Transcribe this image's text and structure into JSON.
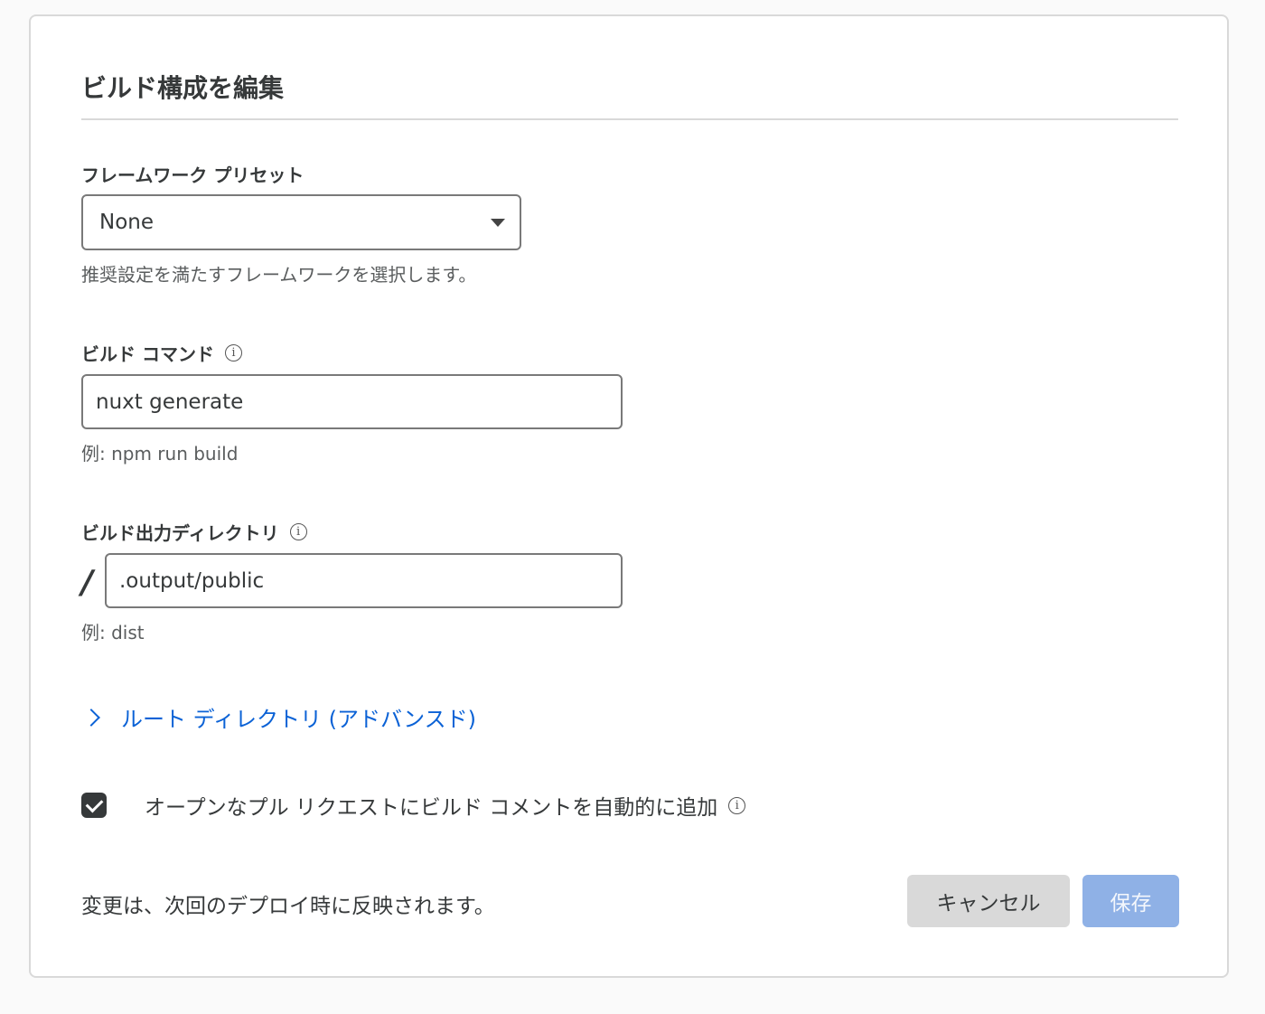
{
  "dialog": {
    "title": "ビルド構成を編集"
  },
  "framework": {
    "label": "フレームワーク プリセット",
    "selected": "None",
    "help": "推奨設定を満たすフレームワークを選択します。"
  },
  "build_command": {
    "label": "ビルド コマンド",
    "value": "nuxt generate",
    "help": "例: npm run build"
  },
  "output_dir": {
    "label": "ビルド出力ディレクトリ",
    "prefix": "/",
    "value": ".output/public",
    "help": "例: dist"
  },
  "root_dir": {
    "label": "ルート ディレクトリ (アドバンスド)"
  },
  "pr_comments": {
    "label": "オープンなプル リクエストにビルド コメントを自動的に追加",
    "checked": true
  },
  "footer": {
    "note": "変更は、次回のデプロイ時に反映されます。",
    "cancel_label": "キャンセル",
    "save_label": "保存"
  },
  "icons": {
    "info": "info-icon",
    "caret": "caret-down-icon",
    "chevron": "chevron-right-icon",
    "check": "check-icon"
  },
  "colors": {
    "link": "#0b62d6",
    "save_disabled": "#8fb1e6",
    "cancel_bg": "#d9d9d9",
    "text": "#36393a"
  }
}
